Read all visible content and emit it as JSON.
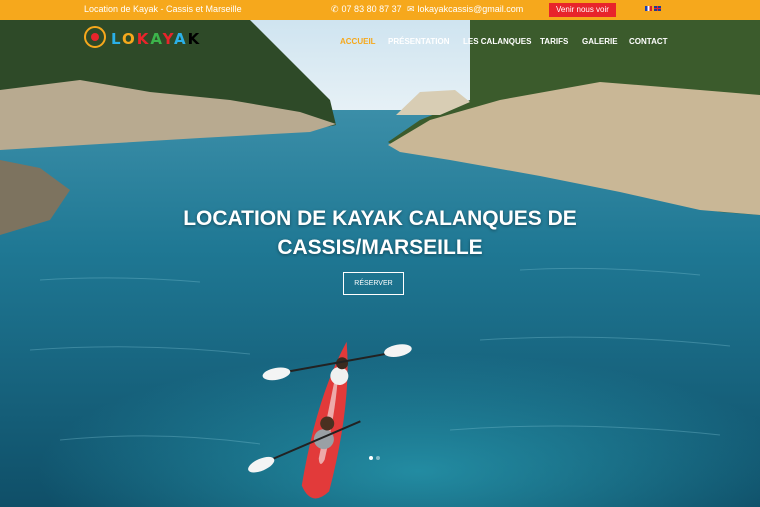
{
  "topbar": {
    "left_text": "Location de Kayak - Cassis et Marseille",
    "phone_icon": "phone-icon",
    "phone": "07 83 80 87 37",
    "email_icon": "envelope-icon",
    "email": "lokayakcassis@gmail.com",
    "cta": "Venir nous voir",
    "flags": [
      "fr-flag-icon",
      "uk-flag-icon"
    ]
  },
  "logo": {
    "text": "LOKAYAK"
  },
  "nav": {
    "items": [
      "ACCUEIL",
      "PRÉSENTATION",
      "LES CALANQUES",
      "TARIFS",
      "GALERIE",
      "CONTACT"
    ],
    "active": "ACCUEIL"
  },
  "hero": {
    "title": "LOCATION DE KAYAK CALANQUES DE CASSIS/MARSEILLE",
    "button": "RÉSERVER",
    "slides_total": 2,
    "slide_active": 1
  },
  "colors": {
    "accent": "#f6a81c",
    "cta": "#e8242b",
    "water": "#1d6f86",
    "text_light": "#ffffff"
  }
}
